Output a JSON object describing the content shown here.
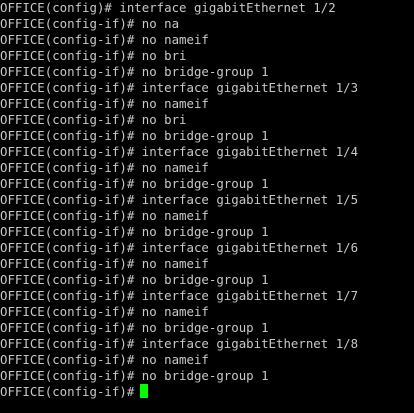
{
  "terminal": {
    "lines": [
      "OFFICE(config)# interface gigabitEthernet 1/2",
      "OFFICE(config-if)# no na",
      "OFFICE(config-if)# no nameif",
      "OFFICE(config-if)# no bri",
      "OFFICE(config-if)# no bridge-group 1",
      "OFFICE(config-if)# interface gigabitEthernet 1/3",
      "OFFICE(config-if)# no nameif",
      "OFFICE(config-if)# no bri",
      "OFFICE(config-if)# no bridge-group 1",
      "OFFICE(config-if)# interface gigabitEthernet 1/4",
      "OFFICE(config-if)# no nameif",
      "OFFICE(config-if)# no bridge-group 1",
      "OFFICE(config-if)# interface gigabitEthernet 1/5",
      "OFFICE(config-if)# no nameif",
      "OFFICE(config-if)# no bridge-group 1",
      "OFFICE(config-if)# interface gigabitEthernet 1/6",
      "OFFICE(config-if)# no nameif",
      "OFFICE(config-if)# no bridge-group 1",
      "OFFICE(config-if)# interface gigabitEthernet 1/7",
      "OFFICE(config-if)# no nameif",
      "OFFICE(config-if)# no bridge-group 1",
      "OFFICE(config-if)# interface gigabitEthernet 1/8",
      "OFFICE(config-if)# no nameif",
      "OFFICE(config-if)# no bridge-group 1"
    ],
    "prompt": "OFFICE(config-if)#",
    "colors": {
      "background": "#000000",
      "text": "#c8c8c8",
      "cursor": "#00ff00"
    }
  }
}
